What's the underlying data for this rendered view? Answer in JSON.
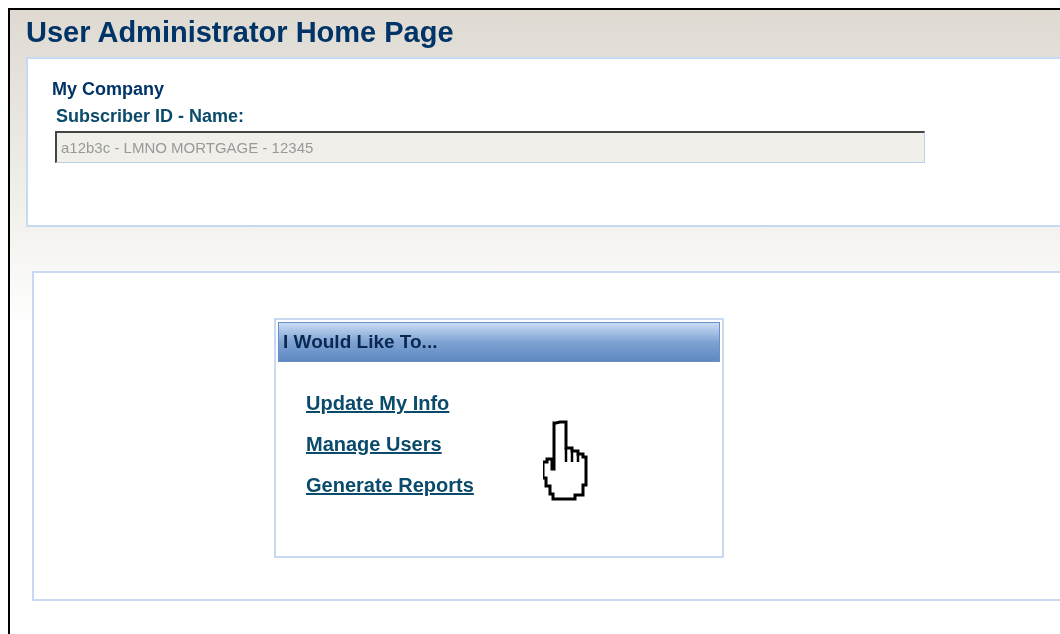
{
  "page": {
    "title": "User Administrator Home Page"
  },
  "company": {
    "heading": "My Company",
    "field_label": "Subscriber ID - Name:",
    "value": "a12b3c - LMNO MORTGAGE - 12345",
    "disabled": true
  },
  "actions": {
    "heading": "I Would Like To...",
    "links": [
      {
        "label": "Update My Info"
      },
      {
        "label": "Manage Users"
      },
      {
        "label": "Generate Reports"
      }
    ]
  }
}
